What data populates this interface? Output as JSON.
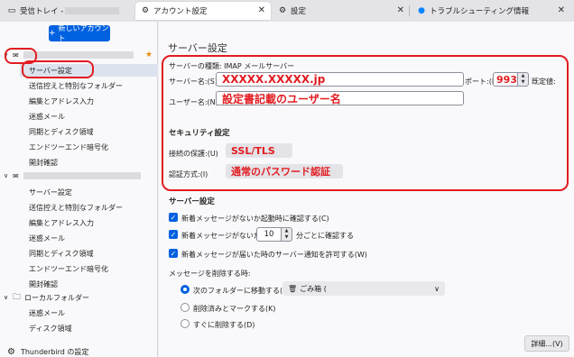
{
  "tabs": [
    {
      "label": "受信トレイ - ",
      "icon": "inbox-icon"
    },
    {
      "label": "アカウント設定",
      "icon": "gear-icon"
    },
    {
      "label": "設定",
      "icon": "gear-icon"
    },
    {
      "label": "トラブルシューティング情報",
      "icon": "thunderbird-icon"
    }
  ],
  "sidebar": {
    "new_account": "新しいアカウント",
    "account1": {
      "items": [
        "サーバー設定",
        "送信控えと特別なフォルダー",
        "編集とアドレス入力",
        "迷惑メール",
        "同期とディスク領域",
        "エンドツーエンド暗号化",
        "開封確認"
      ]
    },
    "account2": {
      "items": [
        "サーバー設定",
        "送信控えと特別なフォルダー",
        "編集とアドレス入力",
        "迷惑メール",
        "同期とディスク領域",
        "エンドツーエンド暗号化",
        "開封確認"
      ]
    },
    "local": {
      "label": "ローカルフォルダー",
      "items": [
        "迷惑メール",
        "ディスク領域"
      ]
    },
    "settings_link": "Thunderbird の設定"
  },
  "main": {
    "title": "サーバー設定",
    "server_type": "サーバーの種類: IMAP メールサーバー",
    "server_name_label": "サーバー名:(S)",
    "server_name_value": "XXXXX.XXXXX.jp",
    "port_label": "ポート:(P)",
    "port_value": "993",
    "port_default": "既定値:",
    "username_label": "ユーザー名:(N)",
    "username_value": "設定書記載のユーザー名",
    "security_heading": "セキュリティ設定",
    "connection_label": "接続の保護:(U)",
    "connection_value": "SSL/TLS",
    "auth_label": "認証方式:(I)",
    "auth_value": "通常のパスワード認証",
    "server_settings_heading": "サーバー設定",
    "cb1": "新着メッセージがないか起動時に確認する(C)",
    "cb2_pre": "新着メッセージがないか(Y)",
    "cb2_value": "10",
    "cb2_post": "分ごとに確認する",
    "cb3": "新着メッセージが届いた時のサーバー通知を許可する(W)",
    "delete_heading": "メッセージを削除する時:",
    "radio1": "次のフォルダーに移動する(O):",
    "radio1_select": "ごみ箱 (",
    "radio2": "削除済みとマークする(K)",
    "radio3": "すぐに削除する(D)",
    "details_button": "詳細...(V)"
  },
  "colors": {
    "accent": "#0061e0",
    "annotation": "#e21c21"
  }
}
